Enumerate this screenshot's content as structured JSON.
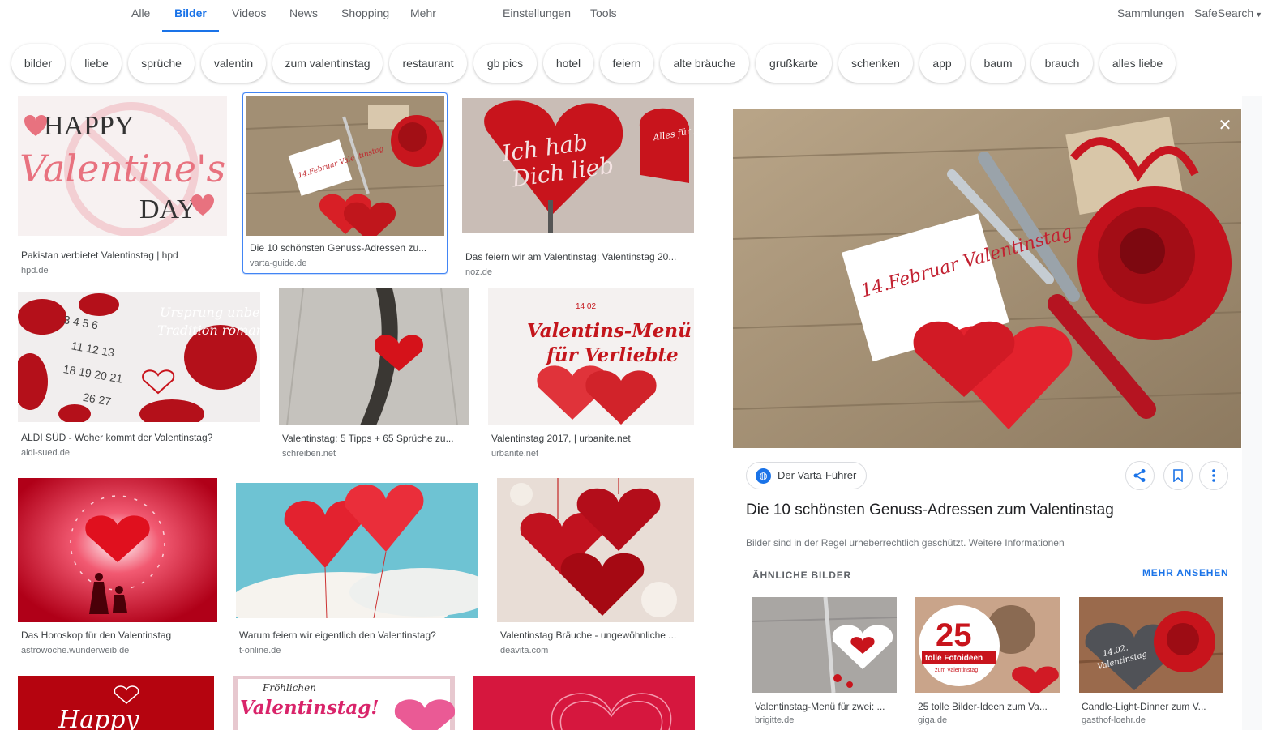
{
  "nav": {
    "tabs": [
      {
        "label": "Alle"
      },
      {
        "label": "Bilder",
        "active": true
      },
      {
        "label": "Videos"
      },
      {
        "label": "News"
      },
      {
        "label": "Shopping"
      },
      {
        "label": "Mehr"
      }
    ],
    "settings_label": "Einstellungen",
    "tools_label": "Tools",
    "collections_label": "Sammlungen",
    "safesearch_label": "SafeSearch"
  },
  "chips": [
    "bilder",
    "liebe",
    "sprüche",
    "valentin",
    "zum valentinstag",
    "restaurant",
    "gb pics",
    "hotel",
    "feiern",
    "alte bräuche",
    "grußkarte",
    "schenken",
    "app",
    "baum",
    "brauch",
    "alles liebe"
  ],
  "results": [
    {
      "caption": "Pakistan verbietet Valentinstag | hpd",
      "source": "hpd.de",
      "art": {
        "line1": "HAPPY",
        "line2": "Valentine's",
        "line3": "DAY"
      }
    },
    {
      "caption": "Die 10 schönsten Genuss-Adressen zu...",
      "source": "varta-guide.de",
      "selected": true,
      "art": {
        "card": "14.Februar Valentinstag"
      }
    },
    {
      "caption": "Das feiern wir am Valentinstag: Valentinstag 20...",
      "source": "noz.de",
      "art": {
        "line1": "Ich hab",
        "line2": "Dich lieb",
        "side": "Alles für Dich"
      }
    },
    {
      "caption": "ALDI SÜD - Woher kommt der Valentinstag?",
      "source": "aldi-sued.de",
      "art": {
        "line1": "Ursprung unbekannt",
        "line2": "Tradition romantisch"
      }
    },
    {
      "caption": "Valentinstag: 5 Tipps + 65 Sprüche zu...",
      "source": "schreiben.net"
    },
    {
      "caption": "Valentinstag 2017, | urbanite.net",
      "source": "urbanite.net",
      "art": {
        "date": "14 02",
        "line1": "Valentins-Menü",
        "line2": "für Verliebte"
      }
    },
    {
      "caption": "Das Horoskop für den Valentinstag",
      "source": "astrowoche.wunderweib.de"
    },
    {
      "caption": "Warum feiern wir eigentlich den Valentinstag?",
      "source": "t-online.de"
    },
    {
      "caption": "Valentinstag Bräuche - ungewöhnliche ...",
      "source": "deavita.com"
    },
    {
      "art": {
        "line1": "Happy"
      }
    },
    {
      "art": {
        "line1": "Fröhlichen",
        "line2": "Valentinstag!"
      }
    },
    {}
  ],
  "panel": {
    "source_name": "Der Varta-Führer",
    "title": "Die 10 schönsten Genuss-Adressen zum Valentinstag",
    "copyright": "Bilder sind in der Regel urheberrechtlich geschützt. Weitere Informationen",
    "similar_heading": "ÄHNLICHE BILDER",
    "more_label": "MEHR ANSEHEN",
    "main_card_text": "14.Februar Valentinstag",
    "similar": [
      {
        "caption": "Valentinstag-Menü für zwei: ...",
        "source": "brigitte.de"
      },
      {
        "caption": "25 tolle Bilder-Ideen zum Va...",
        "source": "giga.de",
        "art": {
          "big": "25",
          "small": "tolle Fotoideen",
          "tiny": "zum Valentinstag"
        }
      },
      {
        "caption": "Candle-Light-Dinner zum V...",
        "source": "gasthof-loehr.de",
        "art": {
          "line1": "14.02.",
          "line2": "Valentinstag"
        }
      }
    ]
  },
  "colors": {
    "accent": "#1a73e8",
    "heart_red": "#d81f26",
    "wood": "#a89379"
  }
}
